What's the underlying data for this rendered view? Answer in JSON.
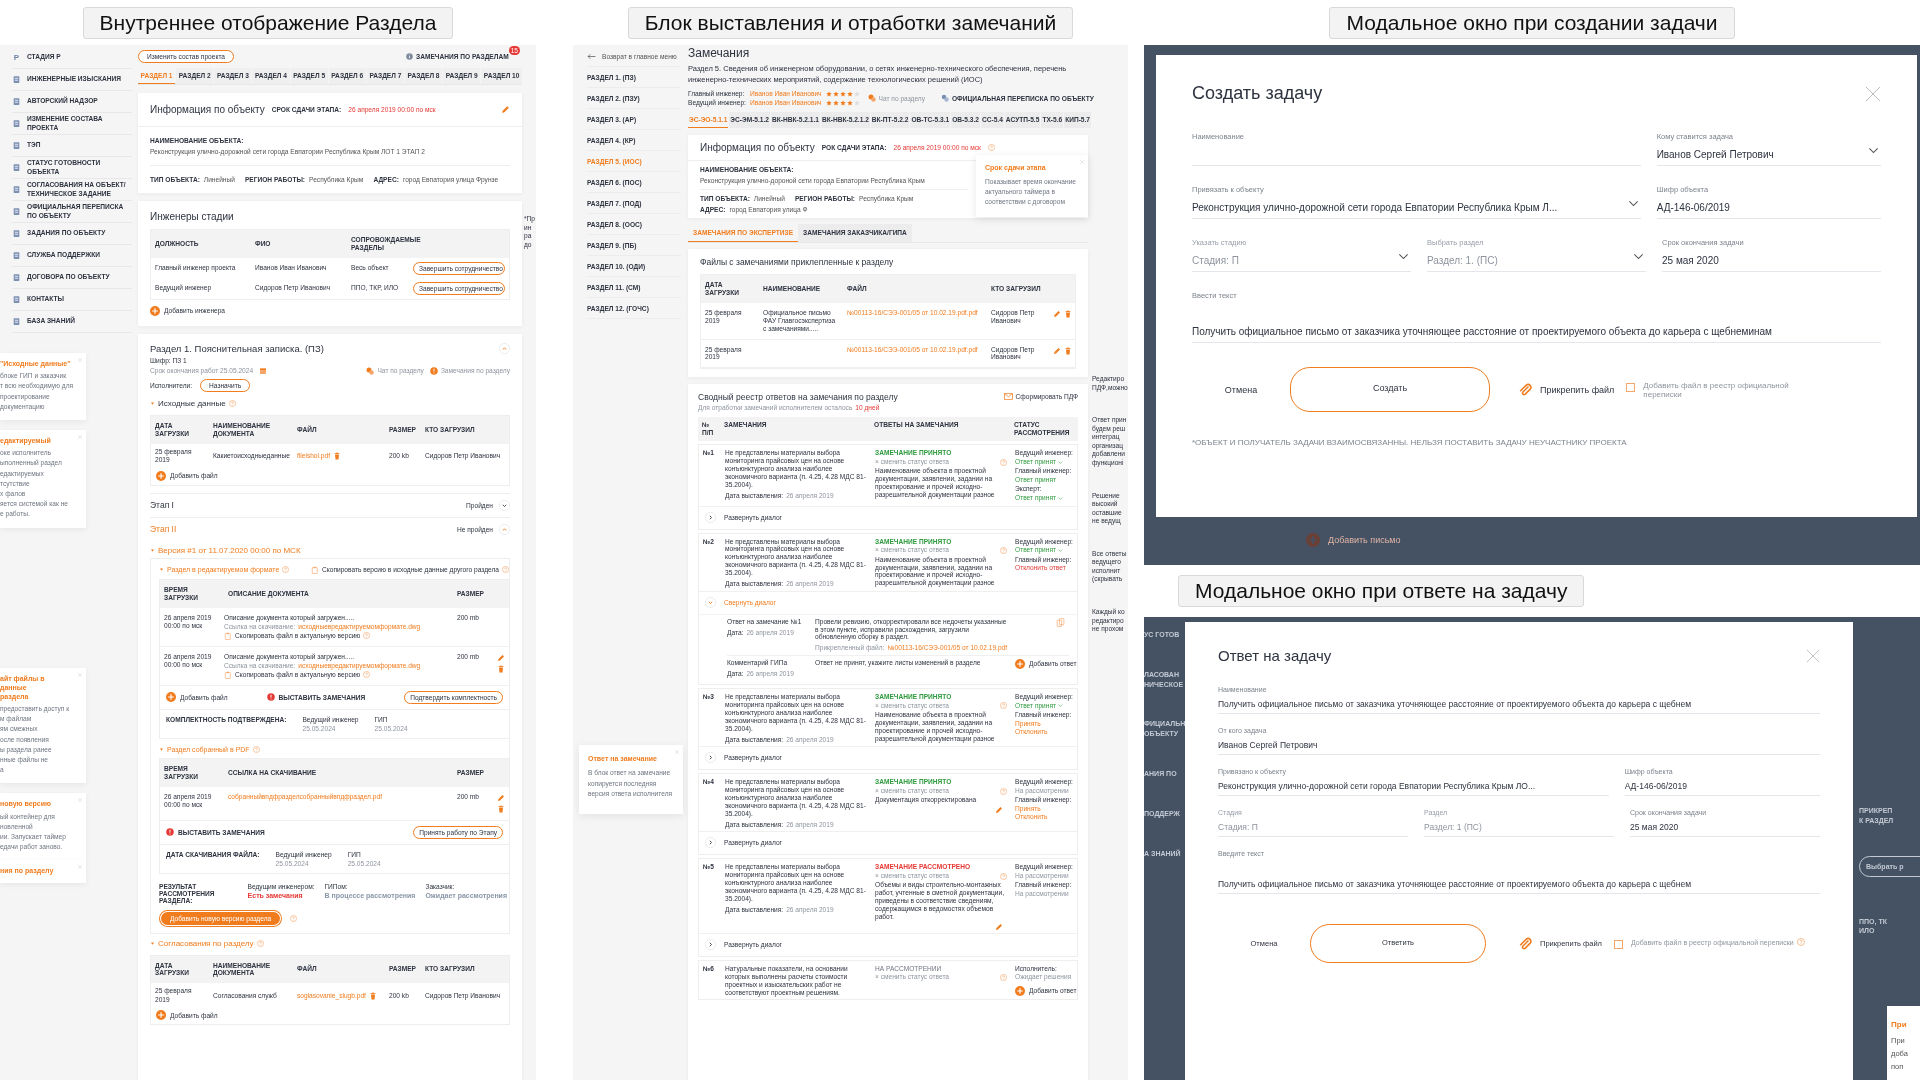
{
  "section_view": {
    "caption": "Внутреннее отображение Раздела",
    "sidebar": [
      {
        "label": "СТАДИЯ Р",
        "glyph": "Р"
      },
      {
        "label": "ИНЖЕНЕРНЫЕ ИЗЫСКАНИЯ"
      },
      {
        "label": "АВТОРСКИЙ НАДЗОР"
      },
      {
        "label": "ИЗМЕНЕНИЕ СОСТАВА ПРОЕКТА"
      },
      {
        "label": "ТЭП"
      },
      {
        "label": "СТАТУС ГОТОВНОСТИ ОБЪЕКТА"
      },
      {
        "label": "СОГЛАСОВАНИЯ НА ОБЪЕКТ/ ТЕХНИЧЕСКОЕ ЗАДАНИЕ"
      },
      {
        "label": "ОФИЦИАЛЬНАЯ ПЕРЕПИСКА ПО ОБЪЕКТУ"
      },
      {
        "label": "ЗАДАНИЯ ПО ОБЪЕКТУ"
      },
      {
        "label": "СЛУЖБА ПОДДЕРЖКИ"
      },
      {
        "label": "ДОГОВОРА ПО ОБЪЕКТУ"
      },
      {
        "label": "КОНТАКТЫ"
      },
      {
        "label": "БАЗА ЗНАНИЙ"
      }
    ],
    "notes": [
      {
        "title": "\"Исходные данные\"",
        "lines": [
          "блоке ГИП и заказчик",
          "т всю необходимую для",
          "проектирование",
          "документацию"
        ]
      },
      {
        "title": "едактируемый",
        "lines": [
          "оке исполнитель",
          "ыполненный раздел",
          "едактируемых",
          "тсутствие",
          "х фалов",
          "яется системой как не",
          "е работы."
        ]
      },
      {
        "title": "айт файлы в\nданные\nраздела",
        "lines": [
          "предоставить доступ к",
          "м файлам",
          "ям смежных",
          "осле появления",
          "ы раздела ранее",
          "нные файлы не",
          "а"
        ]
      },
      {
        "title": "новую версию",
        "lines": [
          "ый контейнер для",
          "новленной",
          "ии. Запускает таймер",
          "едачи работ заново."
        ]
      },
      {
        "title": "ния по разделу"
      }
    ],
    "edge_note": [
      "*Пр",
      "ин",
      "ра",
      "до"
    ],
    "change_button": "Изменить состав проекта",
    "remarks_link": "ЗАМЕЧАНИЯ ПО РАЗДЕЛАМ",
    "remarks_badge": "15",
    "tabs": [
      {
        "label": "РАЗДЕЛ 1",
        "selected": true
      },
      {
        "label": "РАЗДЕЛ 2",
        "selected": false
      },
      {
        "label": "РАЗДЕЛ 3",
        "selected": false
      },
      {
        "label": "РАЗДЕЛ 4",
        "selected": false
      },
      {
        "label": "РАЗДЕЛ 5",
        "selected": false
      },
      {
        "label": "РАЗДЕЛ 6",
        "selected": false
      },
      {
        "label": "РАЗДЕЛ 7",
        "selected": false
      },
      {
        "label": "РАЗДЕЛ 8",
        "selected": false
      },
      {
        "label": "РАЗДЕЛ 9",
        "selected": false
      },
      {
        "label": "РАЗДЕЛ 10",
        "selected": false
      }
    ],
    "info": {
      "title": "Информация по объекту",
      "deadline_label": "СРОК СДАЧИ ЭТАПА:",
      "deadline": "26 апреля 2019 00:00 по мск",
      "name": {
        "label": "НАИМЕНОВАНИЕ ОБЪЕКТА:",
        "value": "Реконструкция улично-дорожной сети города Евпатории Республика Крым ЛОТ 1 ЭТАП 2"
      },
      "facts": [
        {
          "label": "ТИП ОБЪЕКТА:",
          "value": "Линейный"
        },
        {
          "label": "РЕГИОН РАБОТЫ:",
          "value": "Республика Крым"
        },
        {
          "label": "АДРЕС:",
          "value": "город Евпатория улица Фрунзе"
        }
      ]
    },
    "engineers": {
      "title": "Инженеры стадии",
      "columns": [
        "ДОЛЖНОСТЬ",
        "ФИО",
        "СОПРОВОЖДАЕМЫЕ РАЗДЕЛЫ"
      ],
      "rows": [
        {
          "cells": [
            "Главный инженер проекта",
            "Иванов Иван Иванович",
            "Весь объект"
          ],
          "action": "Завершить сотрудничество"
        },
        {
          "cells": [
            "Ведущий инженер",
            "Сидоров Петр Иванович",
            "ППО, ТКР, ИЛО"
          ],
          "action": "Завершить сотрудничество"
        }
      ],
      "add": "Добавить инженера"
    },
    "section": {
      "title": "Раздел 1. Пояснительная записка. (ПЗ)",
      "code": "Шифр: ПЗ 1",
      "deadline": "Срок окончания работ 25.05.2024",
      "chat": "Чат по разделу",
      "remarks": "Замечания по разделу",
      "performers_label": "Исполнители:",
      "assign": "Назначить",
      "source": {
        "title": "Исходные данные",
        "columns": [
          "ДАТА ЗАГРУЗКИ",
          "НАИМЕНОВАНИЕ ДОКУМЕНТА",
          "ФАЙЛ",
          "РАЗМЕР",
          "КТО ЗАГРУЗИЛ"
        ],
        "row": [
          "25 февраля 2019",
          "Какиетоисходныеданные",
          "fileishol.pdf",
          "200 kb",
          "Сидоров Петр Иванович"
        ],
        "add": "Добавить файл"
      },
      "stages": [
        {
          "title": "Этап I",
          "status": "Пройден",
          "expanded": false
        },
        {
          "title": "Этап II",
          "status": "Не пройден",
          "expanded": true
        }
      ],
      "version": "Версия #1 от 11.07.2020 00:00 по МСК",
      "editable": {
        "title": "Раздел в редактируемом формате",
        "copy_version": "Скопировать версию в исходные данные другого раздела",
        "columns": [
          "ВРЕМЯ ЗАГРУЗКИ",
          "ОПИСАНИЕ ДОКУМЕНТА",
          "РАЗМЕР"
        ],
        "rows": [
          {
            "time": "26 апреля 2019\n00:00 по мск",
            "desc": "Описание документа который загружен.....",
            "link_label": "Ссылка на скачивание:",
            "link": "исходныевредактируемомформате.dwg",
            "copy": "Скопировать файл в актуальную версию",
            "size": "200 mb",
            "editable": false
          },
          {
            "time": "26 апреля 2019\n00:00 по мск",
            "desc": "Описание документа который загружен.....",
            "link_label": "Ссылка на скачивание:",
            "link": "исходныевредактируемомформате.dwg",
            "copy": "Скопировать файл в актуальную версию",
            "size": "200 mb",
            "editable": true
          }
        ],
        "add": "Добавить файл",
        "raise": "ВЫСТАВИТЬ ЗАМЕЧАНИЯ",
        "confirm": "Подтвердить комплектность",
        "sign_label": "КОМПЛЕКТНОСТЬ ПОДТВЕРЖДЕНА:",
        "signers": [
          {
            "role": "Ведущий инженер",
            "date": "25.05.2024"
          },
          {
            "role": "ГИП",
            "date": "25.05.2024"
          }
        ]
      },
      "pdf": {
        "title": "Раздел собранный в PDF",
        "columns": [
          "ВРЕМЯ ЗАГРУЗКИ",
          "ССЫЛКА НА СКАЧИВАНИЕ",
          "РАЗМЕР"
        ],
        "row": {
          "time": "26 апреля 2019\n00:00 по мск",
          "link": "собранныйвпдфразделсобранныйвпдфраздел.pdf",
          "size": "200 mb"
        },
        "raise": "ВЫСТАВИТЬ ЗАМЕЧАНИЯ",
        "accept": "Принять работу по Этапу",
        "sign_label": "ДАТА СКАЧИВАНИЯ ФАЙЛА:",
        "signers": [
          {
            "role": "Ведущий инженер",
            "date": "25.05.2024"
          },
          {
            "role": "ГИП",
            "date": "25.05.2024"
          }
        ]
      },
      "result_label": "РЕЗУЛЬТАТ РАССМОТРЕНИЯ РАЗДЕЛА:",
      "results": [
        {
          "who": "Ведущим инженером:",
          "status": "Есть замечания",
          "color": "#e53935"
        },
        {
          "who": "ГИПом:",
          "status": "В процессе рассмотрения",
          "color": "#8a96a8"
        },
        {
          "who": "Заказчик:",
          "status": "Ожидает рассмотрения",
          "color": "#8a96a8"
        }
      ],
      "new_version": "Добавить новую версию раздела",
      "approvals": {
        "title": "Согласования по разделу",
        "columns": [
          "ДАТА ЗАГРУЗКИ",
          "НАИМЕНОВАНИЕ ДОКУМЕНТА",
          "ФАЙЛ",
          "РАЗМЕР",
          "КТО ЗАГРУЗИЛ"
        ],
        "row": [
          "25 февраля 2019",
          "Согласования служб",
          "soglasovanie_slugb.pdf",
          "200 kb",
          "Сидоров Петр Иванович"
        ],
        "add": "Добавить файл"
      }
    }
  },
  "remarks_view": {
    "caption": "Блок выставления и отработки замечаний",
    "back": "Возврат в главное меню",
    "sections": [
      {
        "label": "РАЗДЕЛ 1. (ПЗ)",
        "selected": false
      },
      {
        "label": "РАЗДЕЛ 2. (ПЗУ)",
        "selected": false
      },
      {
        "label": "РАЗДЕЛ 3. (АР)",
        "selected": false
      },
      {
        "label": "РАЗДЕЛ 4. (КР)",
        "selected": false
      },
      {
        "label": "РАЗДЕЛ 5. (ИОС)",
        "selected": true
      },
      {
        "label": "РАЗДЕЛ 6. (ПОС)",
        "selected": false
      },
      {
        "label": "РАЗДЕЛ 7. (ПОД)",
        "selected": false
      },
      {
        "label": "РАЗДЕЛ 8. (ООС)",
        "selected": false
      },
      {
        "label": "РАЗДЕЛ 9. (ПБ)",
        "selected": false
      },
      {
        "label": "РАЗДЕЛ 10. (ОДИ)",
        "selected": false
      },
      {
        "label": "РАЗДЕЛ 11. (СМ)",
        "selected": false
      },
      {
        "label": "РАЗДЕЛ 12. (ГОЧС)",
        "selected": false
      }
    ],
    "title": "Замечания",
    "section_title": "Раздел 5. Сведения об инженерном оборудовании, о сетях инженерно-технического обеспечения, перечень инженерно-технических мероприятий, содержание технологических решений (ИОС)",
    "engineers": [
      {
        "role": "Главный инженер:",
        "name": "Иванов Иван Иванович",
        "stars": 4
      },
      {
        "role": "Ведущий инженер:",
        "name": "Иванов Иван Иванович",
        "stars": 4
      }
    ],
    "chat": "Чат по разделу",
    "official": "ОФИЦИАЛЬНАЯ ПЕРЕПИСКА ПО ОБЪЕКТУ",
    "subtabs": [
      {
        "label": "ЭС-ЭО-5.1.1",
        "selected": true
      },
      {
        "label": "ЭС-ЭМ-5.1.2",
        "selected": false
      },
      {
        "label": "ВК-НВК-5.2.1.1",
        "selected": false
      },
      {
        "label": "ВК-НВК-5.2.1.2",
        "selected": false
      },
      {
        "label": "ВК-ПТ-5.2.2",
        "selected": false
      },
      {
        "label": "ОВ-ТС-5.3.1",
        "selected": false
      },
      {
        "label": "ОВ-5.3.2",
        "selected": false
      },
      {
        "label": "СС-5.4",
        "selected": false
      },
      {
        "label": "АСУТП-5.5",
        "selected": false
      },
      {
        "label": "ТХ-5.6",
        "selected": false
      },
      {
        "label": "КИП-5.7",
        "selected": false
      }
    ],
    "info": {
      "title": "Информация по объекту",
      "deadline_label": "РОК СДАЧИ ЭТАПА:",
      "deadline": "26 апреля 2019 00:00 по мск",
      "name": {
        "label": "НАИМЕНОВАНИЕ ОБЪЕКТА:",
        "value": "Реконструкция улично-дороной сети города Евпатории Республика Крым"
      },
      "facts": [
        {
          "label": "ТИП ОБЪЕКТА:",
          "value": "Линейный"
        },
        {
          "label": "РЕГИОН РАБОТЫ:",
          "value": "Республика Крым"
        },
        {
          "label": "АДРЕС:",
          "value": "город Евпатория улица Ф"
        }
      ]
    },
    "tooltip": {
      "title": "Срок сдачи этапа",
      "text": "Показывает время окончание актуального таймера в соответствии с договором"
    },
    "remark_tabs": [
      {
        "label": "ЗАМЕЧАНИЯ ПО ЭКСПЕРТИЗЕ",
        "selected": true
      },
      {
        "label": "ЗАМЕЧАНИЯ ЗАКАЗЧИКА/ГИПА",
        "selected": false
      }
    ],
    "files": {
      "title": "Файлы с замечаниями приклепленные к разделу",
      "columns": [
        "ДАТА ЗАГРУЗКИ",
        "НАИМЕНОВАНИЕ",
        "ФАЙЛ",
        "КТО ЗАГРУЗИЛ"
      ],
      "rows": [
        {
          "date": "25 февраля 2019",
          "name": "Официальное письмо ФАУ Главгосэкспертиза с замечаниями.....",
          "file": "№00113-16/СЭЭ-001/05 от 10.02.19.pdf.pdf",
          "who": "Сидоров Петр Иванович"
        },
        {
          "date": "25 февраля 2019",
          "file": "№00113-16/СЭЭ-001/05 от 10.02.19.pdf.pdf",
          "who": "Сидоров Петр Иванович"
        }
      ]
    },
    "register": {
      "title": "Сводный реестр ответов на замечания по разделу",
      "note": "Для отработки замечаний исполнителем осталось",
      "days": "10 дней",
      "pdf": "Сформировать ПДФ",
      "columns": [
        "№ П/П",
        "ЗАМЕЧАНИЯ",
        "ОТВЕТЫ НА ЗАМЕЧАНИЯ",
        "СТАТУС РАССМОТРЕНИЯ"
      ],
      "rows": [
        {
          "num": "№1",
          "text": "Не представлены материалы выбора мониторинга прайсовых цен на основе конъюнктурного анализа наиболее экономичного варианта (п. 4.25, 4.28 МДС 81-35.2004).",
          "date_label": "Дата выставления:",
          "date": "26 апреля 2019",
          "status": "ЗАМЕЧАНИЕ ПРИНЯТО",
          "kind": "accepted",
          "change": "× сменить статус ответа",
          "answer": "Наименование объекта в проектной документации, заявлении, задании на проектирование и прочей исходно-разрешительной документации разное",
          "editable": false,
          "reviews": [
            {
              "who": "Ведущий инженер:",
              "lines": [
                "Ответ принят"
              ],
              "kind": "accepted",
              "dropdown": true
            },
            {
              "who": "Главный инженер:",
              "lines": [
                "Ответ принят"
              ],
              "kind": "accepted",
              "dropdown": false
            },
            {
              "who": "Эксперт:",
              "lines": [
                "Ответ принят"
              ],
              "kind": "accepted",
              "dropdown": true
            }
          ],
          "dialog": {
            "label": "Развернуть диалог",
            "expanded": false
          }
        },
        {
          "num": "№2",
          "text": "Не представлены материалы выбора мониторинга прайсовых цен на основе конъюнктурного анализа наиболее экономичного варианта (п. 4.25, 4.28 МДС 81-35.2004).",
          "date_label": "Дата выставления:",
          "date": "26 апреля 2019",
          "status": "ЗАМЕЧАНИЕ ПРИНЯТО",
          "kind": "accepted",
          "change": "× сменить статус ответа",
          "answer": "Наименование объекта в проектной документации, заявлении, задании на проектирование и прочей исходно-разрешительной документации разное",
          "editable": false,
          "reviews": [
            {
              "who": "Ведущий инженер:",
              "lines": [
                "Ответ принят"
              ],
              "kind": "accepted",
              "dropdown": true
            },
            {
              "who": "Главный инженер:",
              "lines": [
                "Отклонить ответ"
              ],
              "kind": "rejected",
              "dropdown": false
            }
          ],
          "dialog": {
            "label": "Свернуть диалог",
            "expanded": true,
            "entries": [
              {
                "title": "Ответ на замечание №1",
                "date_label": "Дата:",
                "date": "26 апреля 2019",
                "text": "Провели ревизию, откорректировали все недочеты указанные в этом пункте, исправили расхождения, загрузили обновленную сборку в раздел.",
                "file_label": "Прикрепленный файл:",
                "file": "№00113-16/СЭЭ-001/05 от 10.02.19.pdf"
              },
              {
                "title": "Комментарий ГИПа",
                "date_label": "Дата:",
                "date": "26 апреля 2019",
                "text": "Ответ не принят, укажите листы изменений в разделе",
                "add": "Добавить ответ"
              }
            ]
          }
        },
        {
          "num": "№3",
          "text": "Не представлены материалы выбора мониторинга прайсовых цен на основе конъюнктурного анализа наиболее экономичного варианта (п. 4.25, 4.28 МДС 81-35.2004).",
          "date_label": "Дата выставления:",
          "date": "26 апреля 2019",
          "status": "ЗАМЕЧАНИЕ ПРИНЯТО",
          "kind": "accepted",
          "change": "× сменить статус ответа",
          "answer": "Наименование объекта в проектной документации, заявлении, задании на проектирование и прочей исходно-разрешительной документации разное",
          "editable": false,
          "reviews": [
            {
              "who": "Ведущий инженер:",
              "lines": [
                "Ответ принят"
              ],
              "kind": "accepted",
              "dropdown": true
            },
            {
              "who": "Главный инженер:",
              "lines": [
                "Принять",
                "Отклонить"
              ],
              "kind": "choice",
              "dropdown": false
            }
          ],
          "dialog": {
            "label": "Развернуть диалог",
            "expanded": false
          }
        },
        {
          "num": "№4",
          "text": "Не представлены материалы выбора мониторинга прайсовых цен на основе конъюнктурного анализа наиболее экономичного варианта (п. 4.25, 4.28 МДС 81-35.2004).",
          "date_label": "Дата выставления:",
          "date": "26 апреля 2019",
          "status": "ЗАМЕЧАНИЕ ПРИНЯТО",
          "kind": "accepted",
          "change": "× сменить статус ответа",
          "answer": "Документация откорректирована",
          "editable": true,
          "reviews": [
            {
              "who": "Ведущий инженер:",
              "lines": [
                "На рассмотрении"
              ],
              "kind": "pending",
              "dropdown": false
            },
            {
              "who": "Главный инженер:",
              "lines": [
                "Принять",
                "Отклонить"
              ],
              "kind": "choice",
              "dropdown": false
            }
          ],
          "dialog": {
            "label": "Развернуть диалог",
            "expanded": false
          }
        },
        {
          "num": "№5",
          "text": "Не представлены материалы выбора мониторинга прайсовых цен на основе конъюнктурного анализа наиболее экономичного варианта (п. 4.25, 4.28 МДС 81-35.2004).",
          "date_label": "Дата выставления:",
          "date": "26 апреля 2019",
          "status": "ЗАМЕЧАНИЕ РАССМОТРЕНО",
          "kind": "reviewed",
          "change": "× сменить статус ответа",
          "answer": "Объемы и виды строительно-монтажных работ, учтенные в сметной документации, приведены в соответствие сведениям, содержащимся в ведомостях объемов работ.",
          "editable": true,
          "reviews": [
            {
              "who": "Ведущий инженер:",
              "lines": [
                "На рассмотрении"
              ],
              "kind": "pending",
              "dropdown": false
            },
            {
              "who": "Главный инженер:",
              "lines": [
                "На рассмотрении"
              ],
              "kind": "pending",
              "dropdown": false
            }
          ],
          "dialog": {
            "label": "Развернуть диалог",
            "expanded": false
          }
        },
        {
          "num": "№6",
          "text": "Натуральные показатели, на основании которых выполнены расчеты стоимости проектных и изыскательских работ не соответствуют проектным решениям.",
          "status": "НА РАССМОТРЕНИИ",
          "kind": "pending",
          "change": "× сменить статус ответа",
          "editable": false,
          "reviews": [
            {
              "who": "Исполнитель:",
              "lines": [
                "Ожидает решения"
              ],
              "kind": "pending",
              "dropdown": false
            }
          ],
          "add": "Добавить ответ"
        }
      ]
    },
    "popup": {
      "title": "Ответ на замечание",
      "text": "В блок ответ на замечание копируется последняя версия ответа исполнителя"
    },
    "edge_notes": [
      [
        "Редактиро",
        "ПДФ,можно"
      ],
      [
        "Ответ прин",
        "будем реш",
        "интеграц",
        "организац",
        "добавлени",
        "функционі"
      ],
      [
        "Решение",
        "высокий",
        "оставшие",
        "не ведущ"
      ],
      [
        "Все ответы",
        "ведущего",
        "исполнит",
        "(скрывать"
      ],
      [
        "Каждый ко",
        "редактиро",
        "не прохом"
      ]
    ]
  },
  "create_task_modal": {
    "caption": "Модальное окно при создании задачи",
    "title": "Создать задачу",
    "rows": [
      {
        "fields": [
          {
            "label": "Наименование",
            "select": false,
            "disabled": false
          },
          {
            "label": "Кому ставится задача",
            "value": "Иванов Сергей Петрович",
            "select": true,
            "disabled": false
          }
        ]
      },
      {
        "fields": [
          {
            "label": "Привязать к объекту",
            "value": "Реконструкция улично-дорожной сети города Евпатории Республика Крым Л...",
            "select": true,
            "disabled": false
          },
          {
            "label": "Шифр объекта",
            "value": "АД-146-06/2019",
            "select": false,
            "disabled": false
          }
        ]
      },
      {
        "fields": [
          {
            "label": "Указать стадию",
            "value": "Стадия: П",
            "select": true,
            "disabled": true
          },
          {
            "label": "Выбрать раздел",
            "value": "Раздел: 1. (ПС)",
            "select": true,
            "disabled": true
          },
          {
            "label": "Срок окончания задачи",
            "value": "25 мая 2020",
            "select": false,
            "disabled": false
          }
        ]
      },
      {
        "fields": [
          {
            "label": "Ввести текст",
            "value": "Получить официальное письмо от заказчика уточняющее расстояние от проектируемого объекта до карьера с щебнеминам",
            "select": false,
            "disabled": false
          }
        ]
      }
    ],
    "cancel": "Отмена",
    "submit": "Создать",
    "attach": "Прикрепить файл",
    "register_check": {
      "label": "Добавить файл в реестр официальной переписки",
      "checked": false,
      "help": false
    },
    "footnote": "*ОБЪЕКТ И ПОЛУЧАТЕЛЬ ЗАДАЧИ ВЗАИМОСВЯЗАННЫ. НЕЛЬЗЯ ПОСТАВИТЬ ЗАДАЧУ НЕУЧАСТНИКУ ПРОЕКТА",
    "behind": "Добавить письмо"
  },
  "reply_task_modal": {
    "caption": "Модальное окно при ответе на задачу",
    "title": "Ответ на задачу",
    "rows": [
      {
        "fields": [
          {
            "label": "Наименование",
            "value": "Получить официальное письмо от заказчика уточняющее расстояние от проектируемого объекта до карьера с щебнем",
            "select": false,
            "disabled": false
          }
        ]
      },
      {
        "fields": [
          {
            "label": "От кого задача",
            "value": "Иванов Сергей Петрович",
            "select": false,
            "disabled": false
          }
        ]
      },
      {
        "fields": [
          {
            "label": "Привязано к объекту",
            "value": "Реконструкция улично-дорожной сети города Евпатории Республика Крым ЛО...",
            "select": false,
            "disabled": false
          },
          {
            "label": "Шифр объекта",
            "value": "АД-146-06/2019",
            "select": false,
            "disabled": false
          }
        ]
      },
      {
        "fields": [
          {
            "label": "Стадия",
            "value": "Стадия: П",
            "select": false,
            "disabled": true
          },
          {
            "label": "Раздел",
            "value": "Раздел: 1 (ПС)",
            "select": false,
            "disabled": true
          },
          {
            "label": "Срок окончания задачи",
            "value": "25 мая 2020",
            "select": false,
            "disabled": false
          }
        ]
      },
      {
        "fields": [
          {
            "label": "Введите текст",
            "value": "Получить официальное письмо от заказчика уточняющее расстояние от проектируемого объекта до карьера с щебнем",
            "select": false,
            "disabled": false
          }
        ]
      }
    ],
    "cancel": "Отмена",
    "submit": "Ответить",
    "attach": "Прикрепить файл",
    "register_check": {
      "label": "Добавить файл в реестр официальной переписки",
      "checked": false,
      "help": true
    },
    "behind_left": [
      "УС ГОТОВ",
      "ЛАСОВАН\nНИЧЕСКОЕ",
      "ФИЦИАЛЬН\nОБЪЕКТУ",
      "АНИЯ ПО",
      "ПОДДЕРЖ",
      "А ЗНАНИЙ"
    ],
    "behind_right": {
      "heading": "ПРИКРЕП\nК РАЗДЕЛ",
      "button": "Выбрать р",
      "cell": "ППО, ТК\nИЛО",
      "popup_title": "При",
      "popup_text": "При\nдоба\nпоп"
    }
  }
}
